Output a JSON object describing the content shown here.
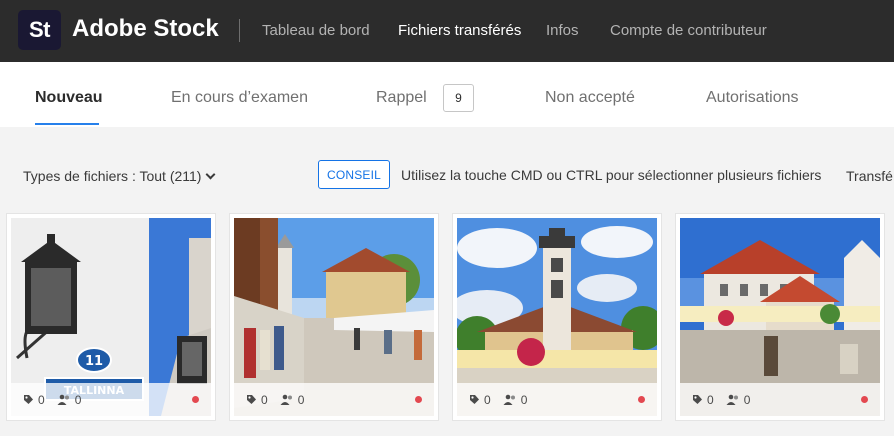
{
  "header": {
    "logo_text": "St",
    "brand": "Adobe Stock",
    "nav": [
      {
        "label": "Tableau de bord",
        "active": false
      },
      {
        "label": "Fichiers transférés",
        "active": true
      },
      {
        "label": "Infos",
        "active": false
      },
      {
        "label": "Compte de contributeur",
        "active": false
      }
    ]
  },
  "tabs": [
    {
      "label": "Nouveau",
      "active": true
    },
    {
      "label": "En cours d’examen",
      "active": false
    },
    {
      "label": "Rappel",
      "active": false,
      "count": "9"
    },
    {
      "label": "Non accepté",
      "active": false
    },
    {
      "label": "Autorisations",
      "active": false
    }
  ],
  "toolbar": {
    "file_type_filter": "Types de fichiers : Tout (211)",
    "conseil_label": "CONSEIL",
    "hint": "Utilisez la touche CMD ou CTRL pour sélectionner plusieurs fichiers",
    "transfer_label": "Transfé"
  },
  "cards": [
    {
      "keywords": "0",
      "releases": "0",
      "status_color": "#e34850",
      "image": "street lamp with Tallinna street sign"
    },
    {
      "keywords": "0",
      "releases": "0",
      "status_color": "#e34850",
      "image": "market stalls in town square"
    },
    {
      "keywords": "0",
      "releases": "0",
      "status_color": "#e34850",
      "image": "town hall tower with flowers"
    },
    {
      "keywords": "0",
      "releases": "0",
      "status_color": "#e34850",
      "image": "square with red-roofed buildings"
    }
  ],
  "colors": {
    "accent": "#1473e6",
    "tab_underline": "#2680eb",
    "status_red": "#e34850",
    "topbar": "#2c2c2c"
  }
}
